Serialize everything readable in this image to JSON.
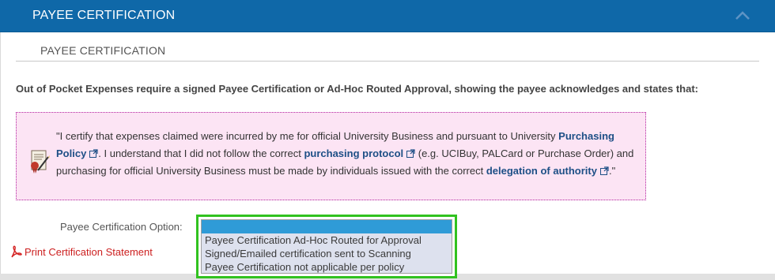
{
  "panel": {
    "header_title": "PAYEE CERTIFICATION",
    "section_title": "PAYEE CERTIFICATION"
  },
  "intro_text": "Out of Pocket Expenses require a signed Payee Certification or Ad-Hoc Routed Approval, showing the payee acknowledges and states that:",
  "certification": {
    "text_1": "\"I certify that expenses claimed were incurred by me for official University Business and pursuant to University ",
    "link_1": "Purchasing Policy",
    "text_2": ". I understand that I did not follow the correct ",
    "link_2": "purchasing protocol",
    "text_3": " (e.g. UCIBuy, PALCard or Purchase Order) and purchasing for official University Business must be made by individuals issued with the correct ",
    "link_3": "delegation of authority",
    "text_4": ".\""
  },
  "option_field": {
    "label": "Payee Certification Option:",
    "options": [
      "",
      "Payee Certification Ad-Hoc Routed for Approval",
      "Signed/Emailed certification sent to Scanning",
      "Payee Certification not applicable per policy"
    ],
    "selected_index": 0
  },
  "print_link": "Print Certification Statement",
  "colors": {
    "header_bg": "#0f68a8",
    "notice_bg": "#fce4f4",
    "notice_border": "#b3239f",
    "link": "#1d4f86",
    "print_link": "#cc1f1f",
    "selected_option": "#2f9bd7",
    "focus_outline": "#31c21f"
  },
  "icons": {
    "collapse": "chevron-up-icon",
    "certificate": "certificate-pen-icon",
    "external_link": "external-link-icon",
    "pdf": "pdf-icon"
  }
}
